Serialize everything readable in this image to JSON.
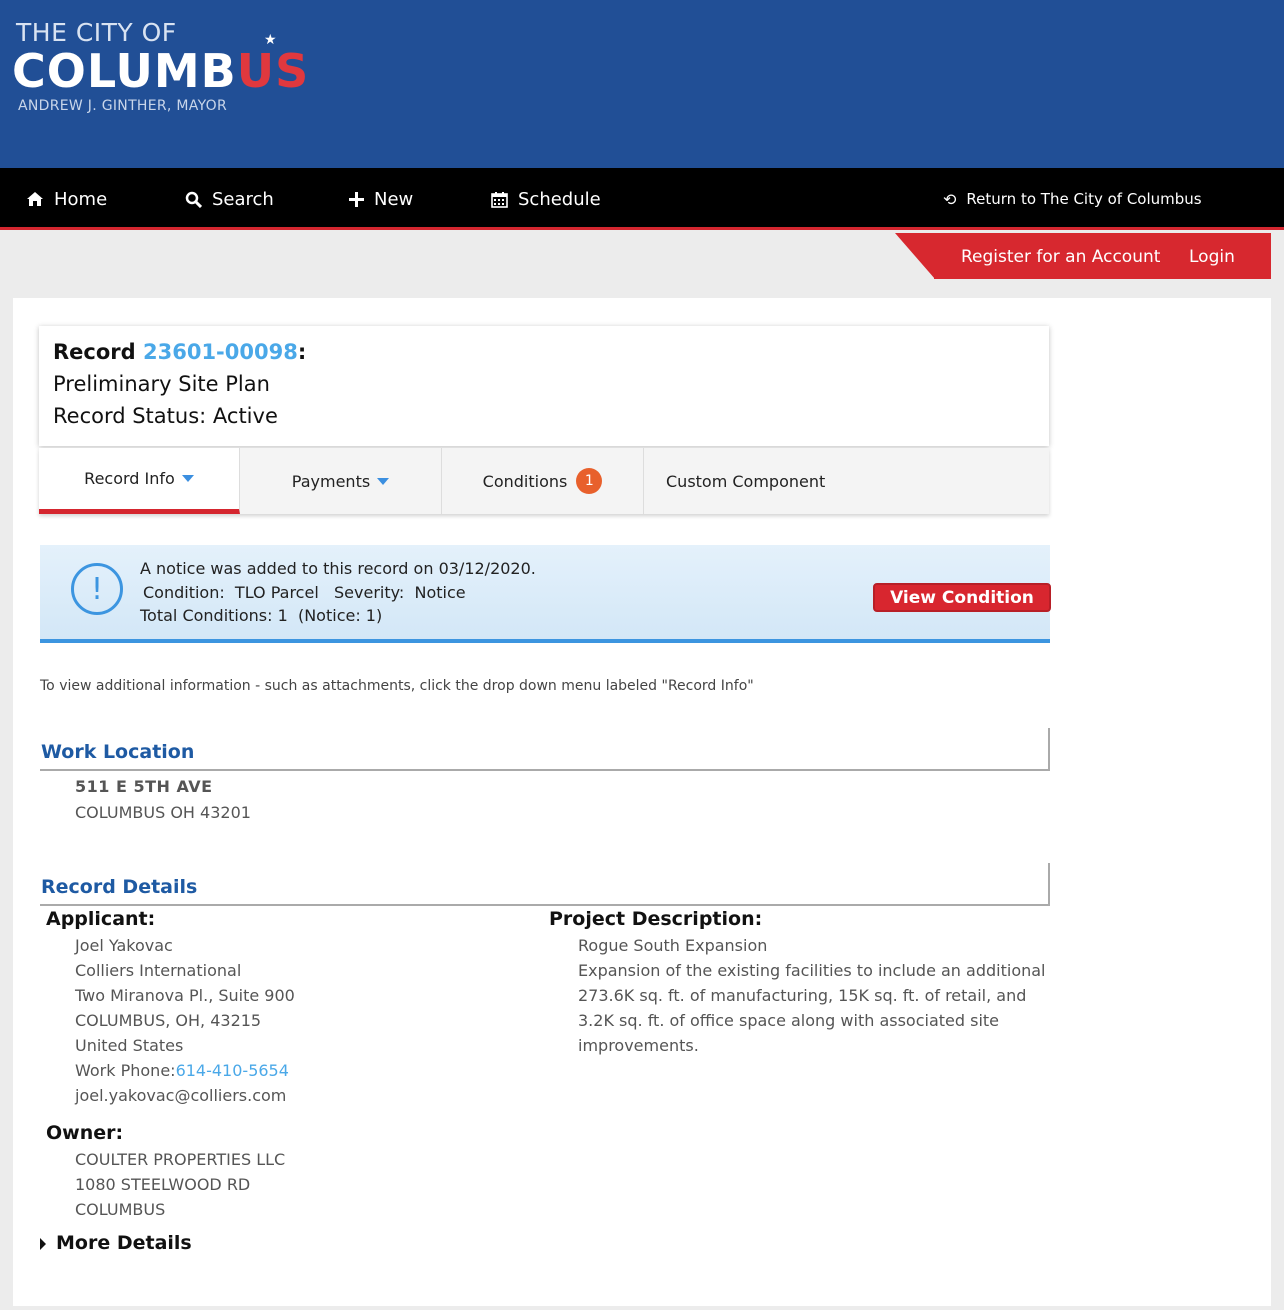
{
  "logo": {
    "line1": "THE CITY OF",
    "line2_main": "COLUMB",
    "line2_accent": "US",
    "line3": "ANDREW J. GINTHER, MAYOR"
  },
  "nav": {
    "home": "Home",
    "search": "Search",
    "new": "New",
    "schedule": "Schedule",
    "return": "Return to The City of Columbus"
  },
  "account": {
    "register": "Register for an Account",
    "login": "Login"
  },
  "record": {
    "prefix": "Record",
    "number": "23601-00098",
    "suffix": ":",
    "type": "Preliminary Site Plan",
    "status": "Record Status: Active"
  },
  "tabs": {
    "record_info": "Record Info",
    "payments": "Payments",
    "conditions": "Conditions",
    "conditions_count": "1",
    "custom": "Custom Component"
  },
  "notice": {
    "line1": "A notice was added to this record on 03/12/2020.",
    "line2": "Condition:  TLO Parcel   Severity:  Notice",
    "line3": "Total Conditions: 1  (Notice: 1)",
    "button": "View Condition"
  },
  "hint": "To view additional information - such as attachments, click the drop down menu labeled \"Record Info\"",
  "work_location": {
    "title": "Work Location",
    "address1": "511 E 5TH AVE",
    "address2": "COLUMBUS OH 43201"
  },
  "record_details": {
    "title": "Record Details",
    "applicant_label": "Applicant:",
    "applicant": {
      "name": "Joel Yakovac",
      "company": "Colliers International",
      "street": "Two Miranova Pl., Suite 900",
      "city": "COLUMBUS, OH, 43215",
      "country": "United States",
      "phone_label": "Work Phone:",
      "phone": "614-410-5654",
      "email": "joel.yakovac@colliers.com"
    },
    "owner_label": "Owner:",
    "owner": {
      "name": "COULTER PROPERTIES LLC",
      "street": "1080 STEELWOOD RD",
      "city": "COLUMBUS"
    },
    "project_label": "Project Description:",
    "project": {
      "name": "Rogue South Expansion",
      "desc1": "Expansion of the existing facilities to include an additional",
      "desc2": "273.6K sq. ft. of manufacturing, 15K sq. ft. of retail, and",
      "desc3": "3.2K sq. ft. of office space along with associated site",
      "desc4": "improvements."
    },
    "more": "More Details"
  },
  "colors": {
    "header_blue": "#214f96",
    "accent_red": "#d5262f",
    "link_blue": "#4aa8e8",
    "section_blue": "#1e5aa3",
    "badge_orange": "#e8602c"
  }
}
